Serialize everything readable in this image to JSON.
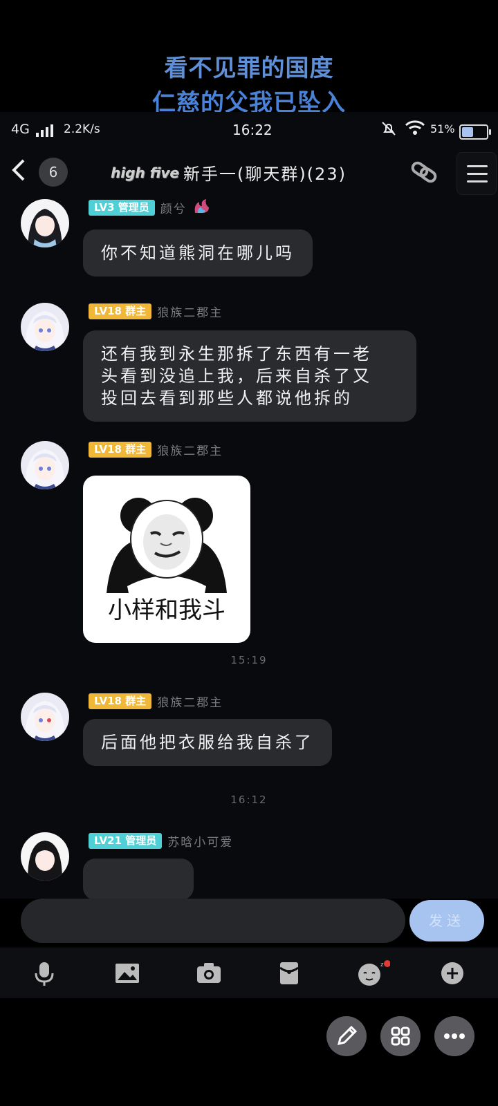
{
  "overlay_caption": {
    "line1": "看不见罪的国度",
    "line2": "仁慈的父我已坠入"
  },
  "status_bar": {
    "network": "4G",
    "speed": "2.2K/s",
    "time": "16:22",
    "battery_percent": "51%",
    "battery_level": 0.51
  },
  "header": {
    "back_icon": "chevron-left-icon",
    "unread_count": "6",
    "group_badge": "high five",
    "title": "新手一(聊天群)(23)",
    "link_icon": "link-icon",
    "menu_icon": "hamburger-menu-icon"
  },
  "messages": [
    {
      "level": "LV3",
      "role": "管理员",
      "nickname": "颜兮",
      "text": "你不知道熊洞在哪儿吗"
    },
    {
      "level": "LV18",
      "role": "群主",
      "nickname": "狼族二郡主",
      "text_lines": [
        "还有我到永生那拆了东西有一老",
        "头看到没追上我，后来自杀了又",
        "投回去看到那些人都说他拆的"
      ]
    },
    {
      "level": "LV18",
      "role": "群主",
      "nickname": "狼族二郡主",
      "sticker_text": "小样和我斗"
    },
    {
      "level": "LV18",
      "role": "群主",
      "nickname": "狼族二郡主",
      "text": "后面他把衣服给我自杀了"
    },
    {
      "level": "LV21",
      "role": "管理员",
      "nickname": "苏晗小可爱"
    }
  ],
  "timestamps": [
    "15:19",
    "16:12"
  ],
  "composer": {
    "input_value": "",
    "send_label": "发送"
  },
  "toolbar_icons": [
    "microphone-icon",
    "image-icon",
    "camera-icon",
    "red-packet-icon",
    "emoji-icon",
    "plus-icon"
  ],
  "floating_buttons": [
    "edit-pencil-icon",
    "grid-apps-icon",
    "more-dots-icon"
  ],
  "colors": {
    "admin_badge": "#4fcfd6",
    "owner_badge": "#f1b736",
    "bubble": "#2a2b2f",
    "send_button": "#a7c4f1",
    "caption": "#5f8fd6"
  }
}
